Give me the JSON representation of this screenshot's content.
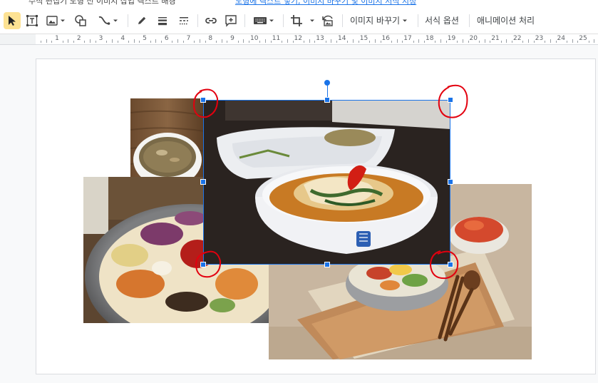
{
  "top_strip": {
    "fragments": [
      {
        "text": "수식 편집기 도형 선 이미지 삽입 텍스트 배경"
      },
      {
        "text": "도형에 텍스트 넣기, 이미지 바꾸기 및 이미지 서식 지정",
        "link": true
      }
    ]
  },
  "toolbar": {
    "replace_image_label": "이미지 바꾸기",
    "format_options_label": "서식 옵션",
    "animate_label": "애니메이션 처리"
  },
  "ruler": {
    "numbers": [
      "1",
      "2",
      "3",
      "4",
      "5",
      "6",
      "7",
      "8",
      "9",
      "10",
      "11",
      "12",
      "13",
      "14",
      "15",
      "16",
      "17",
      "18",
      "19",
      "20",
      "21",
      "22",
      "23",
      "24",
      "25"
    ]
  },
  "colors": {
    "accent": "#1a73e8",
    "select_tool_bg": "#fde293",
    "annotation": "#e3000f"
  },
  "icons": [
    "select-arrow-icon",
    "text-box-icon",
    "image-icon",
    "shapes-icon",
    "line-icon",
    "pen-icon",
    "line-weight-icon",
    "line-dash-icon",
    "link-icon",
    "add-comment-icon",
    "keyboard-icon",
    "crop-icon",
    "reset-image-icon"
  ],
  "slide": {
    "images": [
      "mushroom-soup-photo",
      "bibimbap-bowl-photo",
      "kimchi-bibimbap-photo",
      "noodle-soup-photo"
    ],
    "selected_image": "noodle-soup-photo"
  }
}
